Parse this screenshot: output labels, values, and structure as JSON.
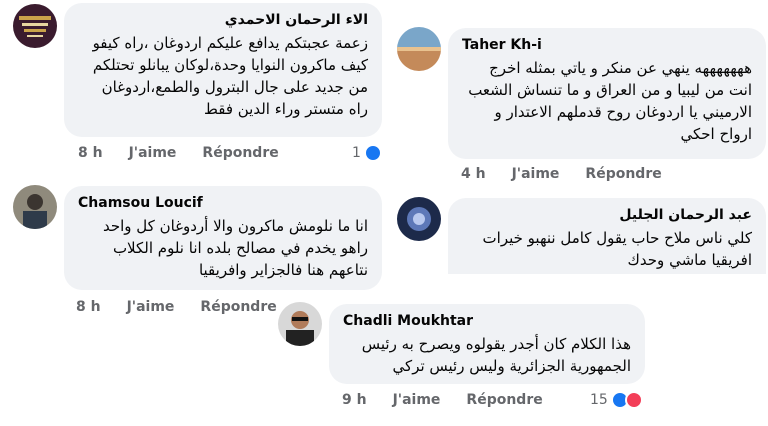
{
  "comments": [
    {
      "name": "الاء الرحمان الاحمدي",
      "text": "زعمة عجبتكم يدافع عليكم اردوغان ،راه كيفو كيف ماكرون النوايا وحدة،لوكان يبانلو تحتلكم من جديد على جال البترول والطمع،اردوغان راه متستر وراء الدين فقط",
      "time": "8 h",
      "like": "J'aime",
      "reply": "Répondre",
      "reactions": "1"
    },
    {
      "name": "Taher Kh-i",
      "text": "هههههههه ينهي عن منكر و ياتي بمثله اخرج انت من ليبيا و من العراق و ما تنساش الشعب الارميني يا اردوغان روح قدملهم الاعتدار و ارواح احكي",
      "time": "4 h",
      "like": "J'aime",
      "reply": "Répondre"
    },
    {
      "name": "Chamsou Loucif",
      "text": "انا ما نلومش ماكرون والا أردوغان كل واحد راهو يخدم في مصالح بلده انا نلوم الكلاب نتاعهم هنا فالجزاير وافريقيا",
      "time": "8 h",
      "like": "J'aime",
      "reply": "Répondre"
    },
    {
      "name": "عبد الرحمان الجليل",
      "text": "كلي ناس ملاح حاب يقول كامل ننهبو خيرات افريقيا ماشي وحدك",
      "time": "",
      "like": "",
      "reply": ""
    },
    {
      "name": "Chadli Moukhtar",
      "text": "هذا الكلام كان أجدر يقولوه ويصرح به رئيس الجمهورية الجزائرية وليس رئيس تركي",
      "time": "9 h",
      "like": "J'aime",
      "reply": "Répondre",
      "reactions": "15"
    }
  ]
}
